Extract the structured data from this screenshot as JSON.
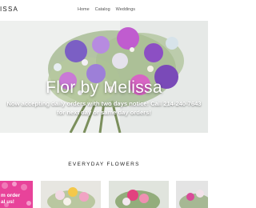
{
  "header": {
    "logo_text": "ISSA",
    "nav": [
      "Home",
      "Catalog",
      "Weddings"
    ]
  },
  "hero": {
    "title": "Flor by Melissa",
    "line1": "Now accepting daily orders with two days notice! Call 214-240-7643",
    "line2": "for next day or same day orders!"
  },
  "section": {
    "title": "EVERYDAY FLOWERS"
  },
  "tiles": {
    "promo_line1": "m order",
    "promo_line2": "al us!"
  },
  "colors": {
    "accent_pink": "#e8439a",
    "text": "#222222",
    "hero_bg": "#eef0ef"
  }
}
